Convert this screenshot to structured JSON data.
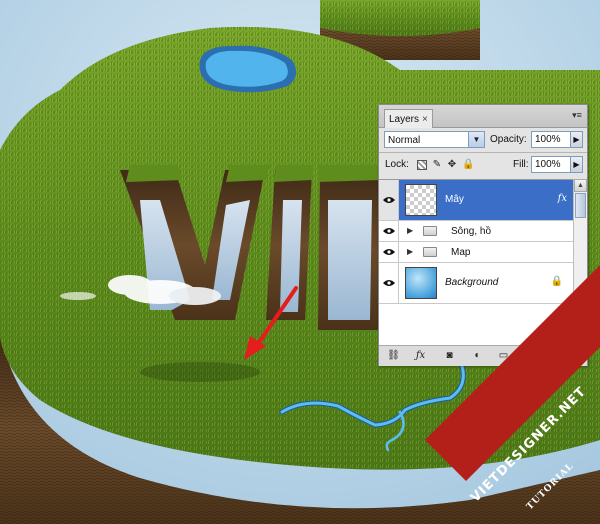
{
  "panel": {
    "tab_label": "Layers",
    "close_glyph": "×",
    "menu_glyph": "▾≡",
    "blend_mode": "Normal",
    "opacity_label": "Opacity:",
    "opacity_value": "100%",
    "lock_label": "Lock:",
    "fill_label": "Fill:",
    "fill_value": "100%",
    "layers": [
      {
        "name": "Mây",
        "selected": true,
        "has_fx": true,
        "fx_label": "fx"
      },
      {
        "name": "Sông, hồ",
        "type": "group"
      },
      {
        "name": "Map",
        "type": "group"
      },
      {
        "name": "Background",
        "locked": true
      }
    ]
  },
  "watermark": {
    "site": "VIETDESIGNER.NET",
    "sub": "TUTORIAL"
  },
  "colors": {
    "selected_row": "#3a6ec7",
    "watermark_red": "#b3201a",
    "grass": "#5d8a1f",
    "sky": "#a9cbe2"
  }
}
